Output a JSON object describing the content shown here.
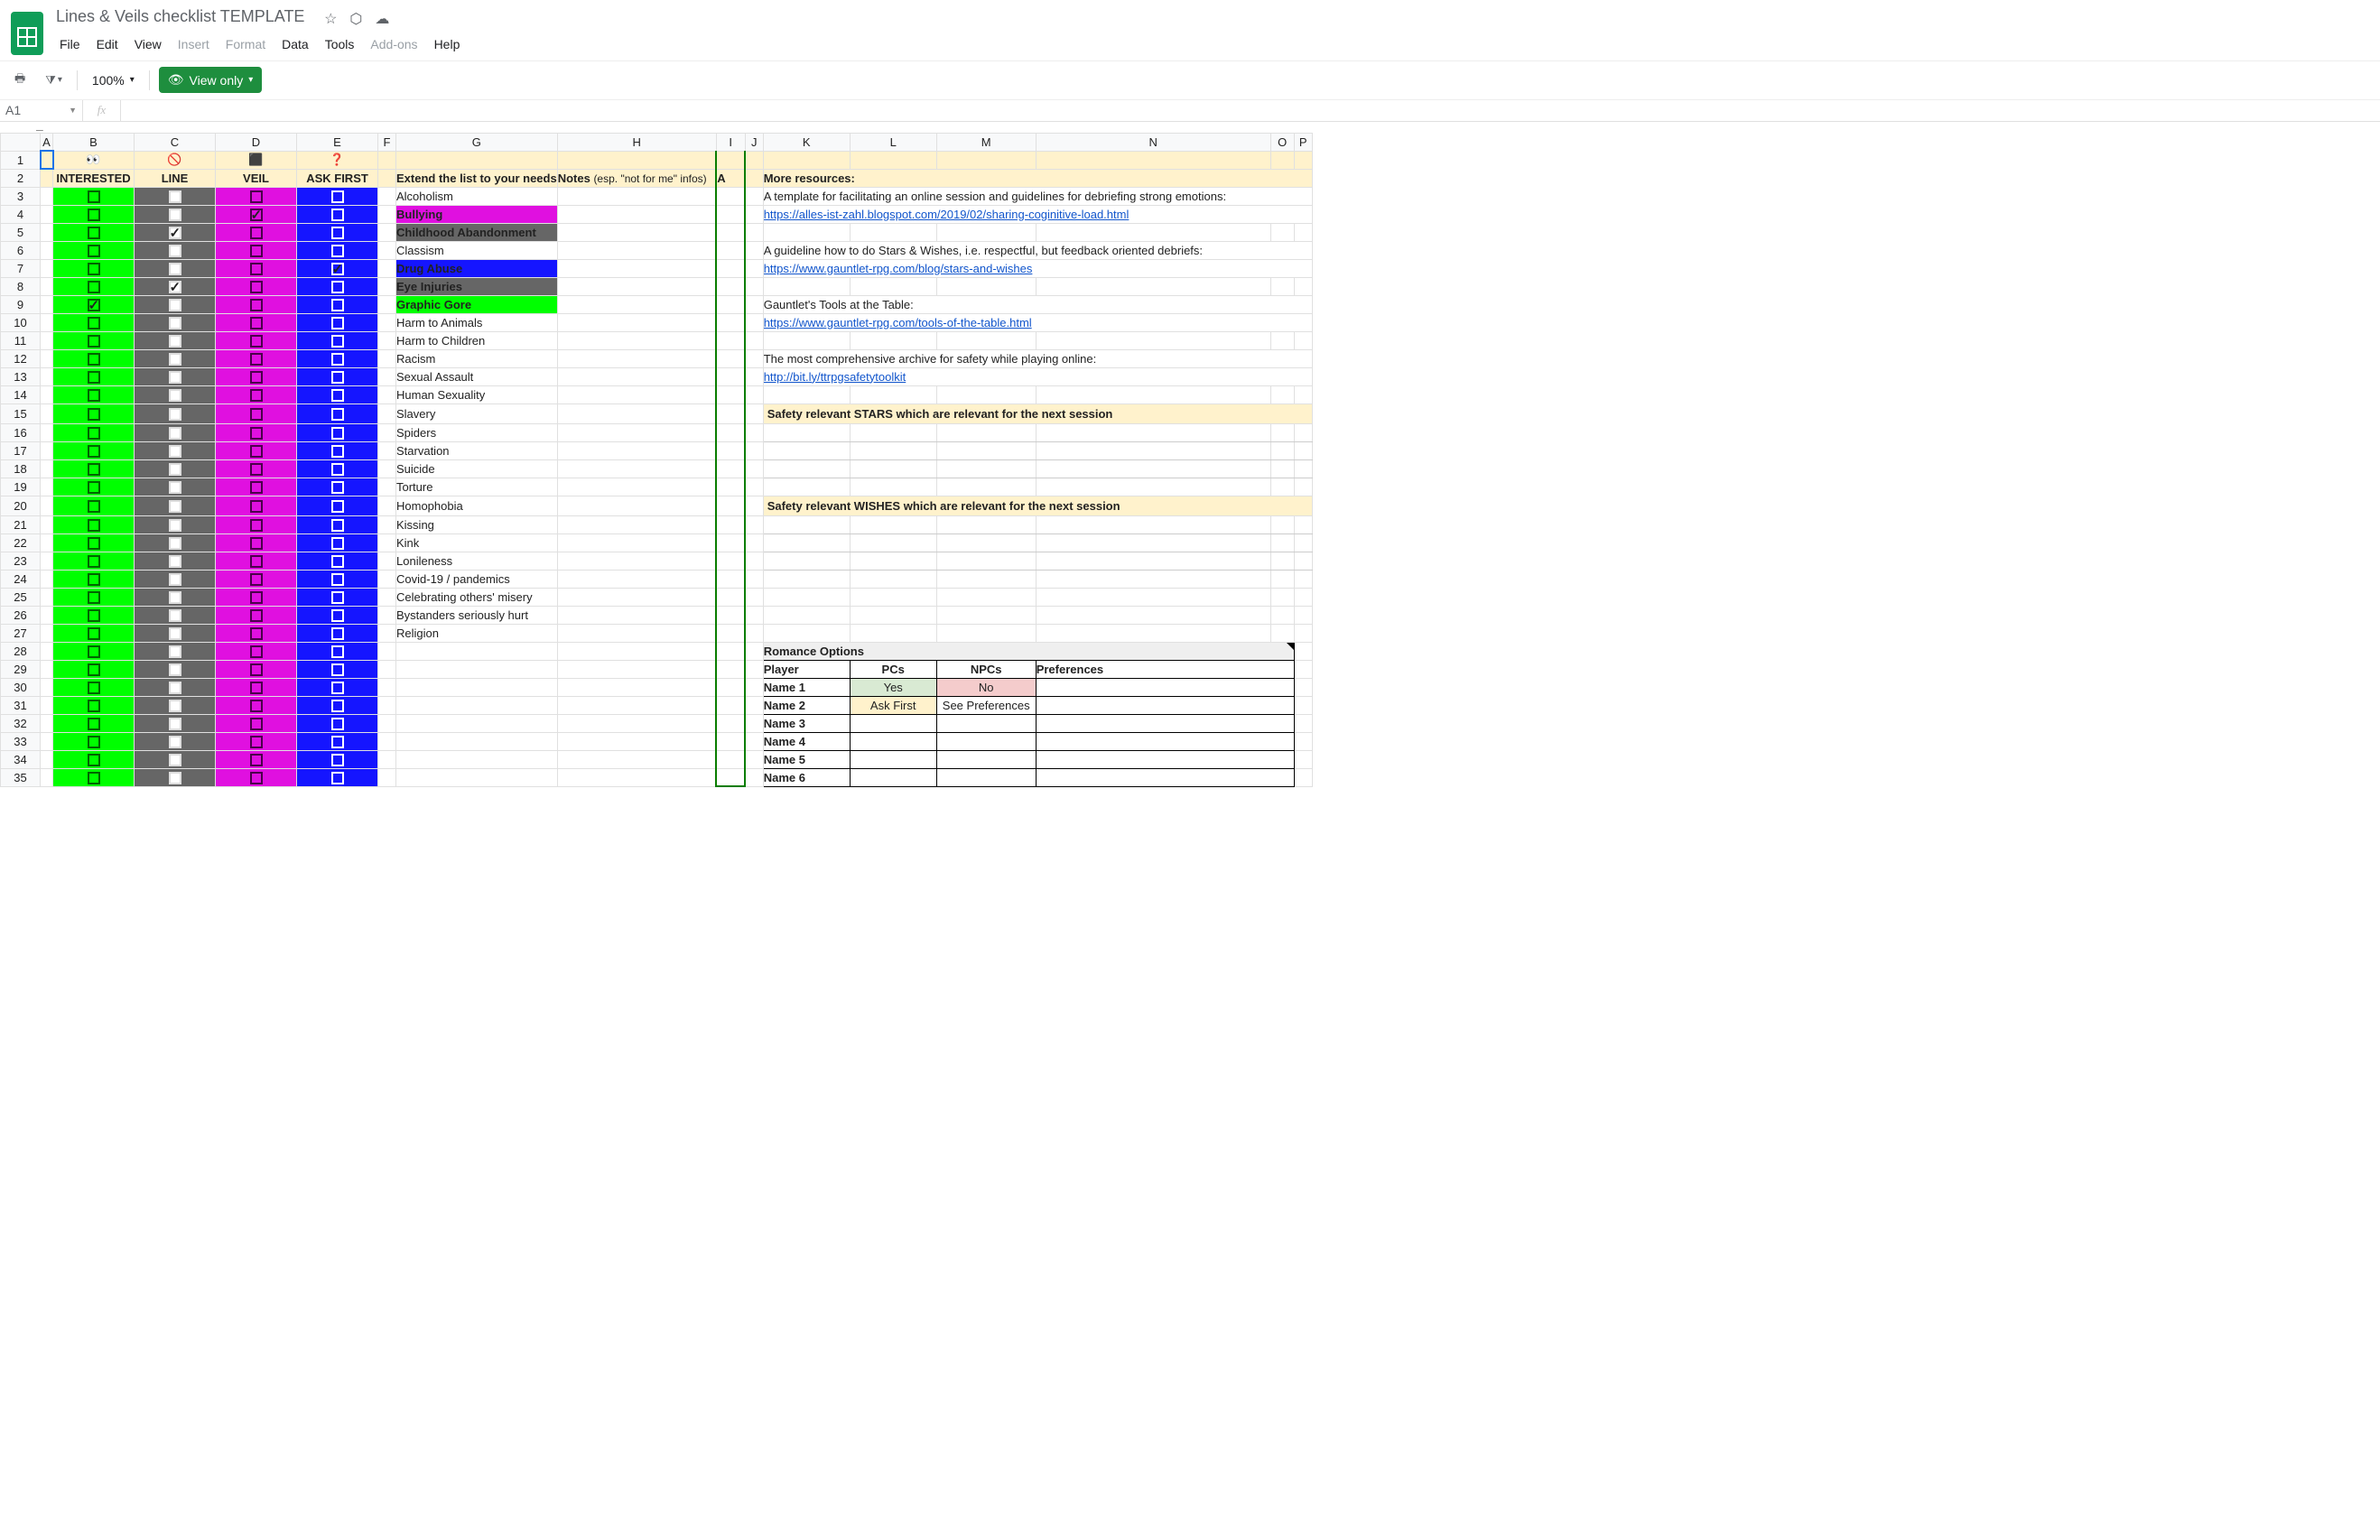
{
  "doc": {
    "title": "Lines & Veils checklist TEMPLATE"
  },
  "menu": {
    "file": "File",
    "edit": "Edit",
    "view": "View",
    "insert": "Insert",
    "format": "Format",
    "data": "Data",
    "tools": "Tools",
    "addons": "Add-ons",
    "help": "Help"
  },
  "toolbar": {
    "zoom": "100%",
    "view_only": "View only"
  },
  "namebox": {
    "value": "A1"
  },
  "columns": [
    "A",
    "B",
    "C",
    "D",
    "E",
    "F",
    "G",
    "H",
    "I",
    "J",
    "K",
    "L",
    "M",
    "N",
    "O",
    "P"
  ],
  "icons": {
    "interested": "👀",
    "line": "🚫",
    "veil": "⬛",
    "ask": "❓"
  },
  "headers": {
    "interested": "INTERESTED",
    "line": "LINE",
    "veil": "VEIL",
    "ask": "ASK FIRST",
    "extend": "Extend the list to your needs",
    "notes": "Notes",
    "notes_sub": "(esp. \"not for me\" infos)",
    "a_col": "A",
    "more": "More resources:"
  },
  "topics": [
    {
      "t": "Alcoholism",
      "hl": ""
    },
    {
      "t": "Bullying",
      "hl": "magenta",
      "veil": true
    },
    {
      "t": "Childhood Abandonment",
      "hl": "gray",
      "line": true
    },
    {
      "t": "Classism",
      "hl": ""
    },
    {
      "t": "Drug Abuse",
      "hl": "blue",
      "ask": true
    },
    {
      "t": "Eye Injuries",
      "hl": "gray",
      "line": true
    },
    {
      "t": "Graphic Gore",
      "hl": "green",
      "interested": true
    },
    {
      "t": "Harm to Animals",
      "hl": ""
    },
    {
      "t": "Harm to Children",
      "hl": ""
    },
    {
      "t": "Racism",
      "hl": ""
    },
    {
      "t": "Sexual Assault",
      "hl": ""
    },
    {
      "t": "Human Sexuality",
      "hl": ""
    },
    {
      "t": "Slavery",
      "hl": ""
    },
    {
      "t": "Spiders",
      "hl": ""
    },
    {
      "t": "Starvation",
      "hl": ""
    },
    {
      "t": "Suicide",
      "hl": ""
    },
    {
      "t": "Torture",
      "hl": ""
    },
    {
      "t": "Homophobia",
      "hl": ""
    },
    {
      "t": "Kissing",
      "hl": ""
    },
    {
      "t": "Kink",
      "hl": ""
    },
    {
      "t": "Lonileness",
      "hl": ""
    },
    {
      "t": "Covid-19 / pandemics",
      "hl": ""
    },
    {
      "t": "Celebrating others' misery",
      "hl": ""
    },
    {
      "t": "Bystanders seriously hurt",
      "hl": ""
    },
    {
      "t": "Religion",
      "hl": ""
    }
  ],
  "resources": {
    "line1": "A template for facilitating an online session and guidelines for debriefing strong emotions:",
    "link1": "https://alles-ist-zahl.blogspot.com/2019/02/sharing-coginitive-load.html",
    "line2": "A guideline how to do Stars & Wishes, i.e. respectful, but feedback oriented debriefs:",
    "link2": "https://www.gauntlet-rpg.com/blog/stars-and-wishes",
    "line3": "Gauntlet's Tools at the Table:",
    "link3": "https://www.gauntlet-rpg.com/tools-of-the-table.html",
    "line4": "The most comprehensive archive for safety while playing online:",
    "link4": "http://bit.ly/ttrpgsafetytoolkit"
  },
  "sections": {
    "stars": "Safety relevant STARS which are relevant for the next session",
    "wishes": "Safety relevant WISHES which are relevant for the next session"
  },
  "romance": {
    "title": "Romance Options",
    "cols": {
      "player": "Player",
      "pcs": "PCs",
      "npcs": "NPCs",
      "prefs": "Preferences"
    },
    "rows": [
      {
        "name": "Name 1",
        "pcs": "Yes",
        "pcs_cls": "yes-cell",
        "npcs": "No",
        "npcs_cls": "no-cell"
      },
      {
        "name": "Name 2",
        "pcs": "Ask First",
        "pcs_cls": "ask-cell",
        "npcs": "See Preferences",
        "npcs_cls": "see-cell"
      },
      {
        "name": "Name 3"
      },
      {
        "name": "Name 4"
      },
      {
        "name": "Name 5"
      },
      {
        "name": "Name 6"
      }
    ]
  }
}
